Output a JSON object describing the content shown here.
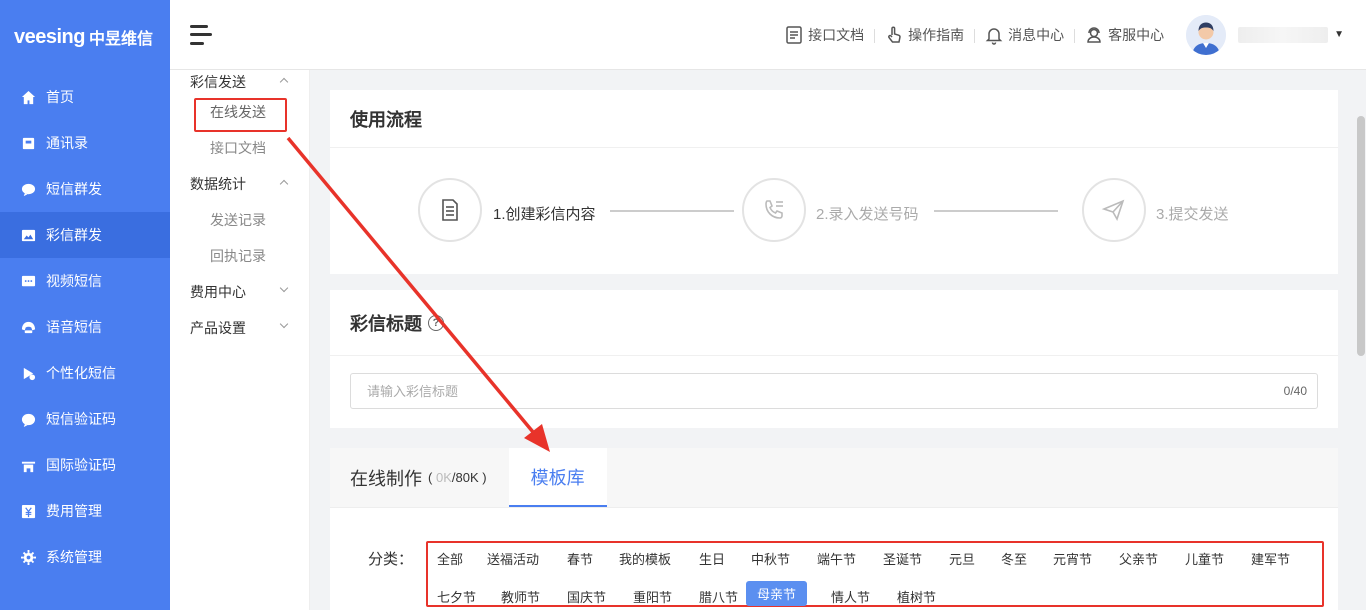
{
  "app": {
    "logo_text": "veesing",
    "logo_cn": "中昱维信"
  },
  "sidebar": {
    "items": [
      {
        "label": "首页",
        "icon": "home-icon"
      },
      {
        "label": "通讯录",
        "icon": "contacts-icon"
      },
      {
        "label": "短信群发",
        "icon": "sms-icon"
      },
      {
        "label": "彩信群发",
        "icon": "image-message-icon",
        "active": true
      },
      {
        "label": "视频短信",
        "icon": "video-message-icon"
      },
      {
        "label": "语音短信",
        "icon": "voice-icon"
      },
      {
        "label": "个性化短信",
        "icon": "personalize-icon"
      },
      {
        "label": "短信验证码",
        "icon": "verify-icon"
      },
      {
        "label": "国际验证码",
        "icon": "international-icon"
      },
      {
        "label": "费用管理",
        "icon": "yen-icon"
      },
      {
        "label": "系统管理",
        "icon": "gear-icon"
      }
    ]
  },
  "header": {
    "links": [
      {
        "label": "接口文档",
        "icon": "api-doc-icon"
      },
      {
        "label": "操作指南",
        "icon": "hand-pointer-icon"
      },
      {
        "label": "消息中心",
        "icon": "bell-icon"
      },
      {
        "label": "客服中心",
        "icon": "customer-service-icon"
      }
    ]
  },
  "submenu": {
    "group1": "彩信发送",
    "group1_items": [
      "在线发送",
      "接口文档"
    ],
    "group2": "数据统计",
    "group2_items": [
      "发送记录",
      "回执记录"
    ],
    "group3": "费用中心",
    "group4": "产品设置"
  },
  "flow": {
    "title": "使用流程",
    "steps": [
      {
        "label": "1.创建彩信内容"
      },
      {
        "label": "2.录入发送号码"
      },
      {
        "label": "3.提交发送"
      }
    ]
  },
  "mms_title": {
    "label": "彩信标题",
    "placeholder": "请输入彩信标题",
    "count": "0/40"
  },
  "editor": {
    "tab_online": "在线制作",
    "tab_online_size_open": "(",
    "tab_online_used": "0K",
    "tab_online_total": "/80K",
    "tab_online_size_close": ")",
    "tab_templates": "模板库",
    "category_label": "分类：",
    "categories_row1": [
      "全部",
      "送福活动",
      "春节",
      "我的模板",
      "生日",
      "中秋节",
      "端午节",
      "圣诞节",
      "元旦",
      "冬至",
      "元宵节",
      "父亲节",
      "儿童节",
      "建军节"
    ],
    "categories_row2": [
      "七夕节",
      "教师节",
      "国庆节",
      "重阳节",
      "腊八节",
      "母亲节",
      "情人节",
      "植树节"
    ],
    "active_category": "母亲节"
  },
  "colors": {
    "sidebar": "#4a7ef0",
    "accent": "#4a7ef0",
    "annotation": "#e8332a"
  }
}
